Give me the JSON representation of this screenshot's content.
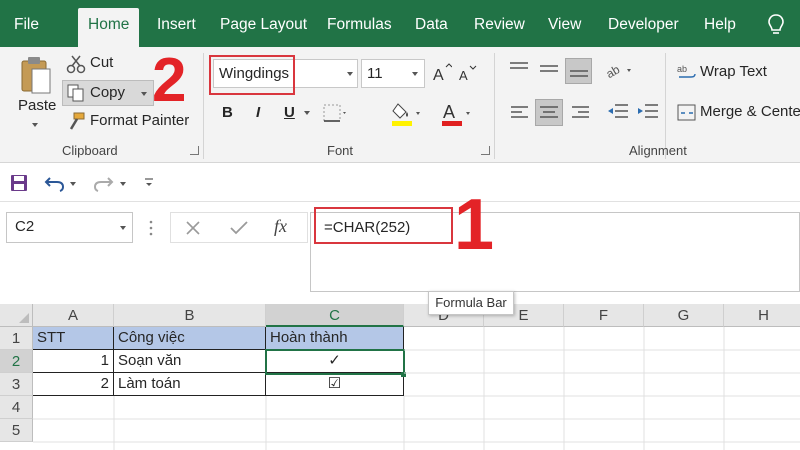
{
  "tabs": [
    "File",
    "Home",
    "Insert",
    "Page Layout",
    "Formulas",
    "Data",
    "Review",
    "View",
    "Developer",
    "Help"
  ],
  "ribbon": {
    "clipboard": {
      "paste": "Paste",
      "cut": "Cut",
      "copy": "Copy",
      "format_painter": "Format Painter",
      "label": "Clipboard"
    },
    "font": {
      "name": "Wingdings",
      "size": "11",
      "bold": "B",
      "italic": "I",
      "underline": "U",
      "font_color_letter": "A",
      "label": "Font"
    },
    "alignment": {
      "wrap_text": "Wrap Text",
      "merge": "Merge & Cente",
      "label": "Alignment"
    }
  },
  "annotations": {
    "step1": "1",
    "step2": "2"
  },
  "formula_bar": {
    "name_box": "C2",
    "fx": "fx",
    "formula": "=CHAR(252)",
    "tooltip": "Formula Bar"
  },
  "sheet": {
    "columns": [
      "A",
      "B",
      "C",
      "D",
      "E",
      "F",
      "G",
      "H"
    ],
    "rows": [
      "1",
      "2",
      "3",
      "4",
      "5"
    ],
    "selected_cell": "C2",
    "header_row": [
      "STT",
      "Công việc",
      "Hoàn thành"
    ],
    "data_rows": [
      [
        "1",
        "Soạn văn",
        "✓"
      ],
      [
        "2",
        "Làm toán",
        "☑"
      ]
    ]
  },
  "colors": {
    "excel_green": "#217346",
    "header_fill": "#b4c7e7",
    "annotation_red": "#e32327"
  }
}
